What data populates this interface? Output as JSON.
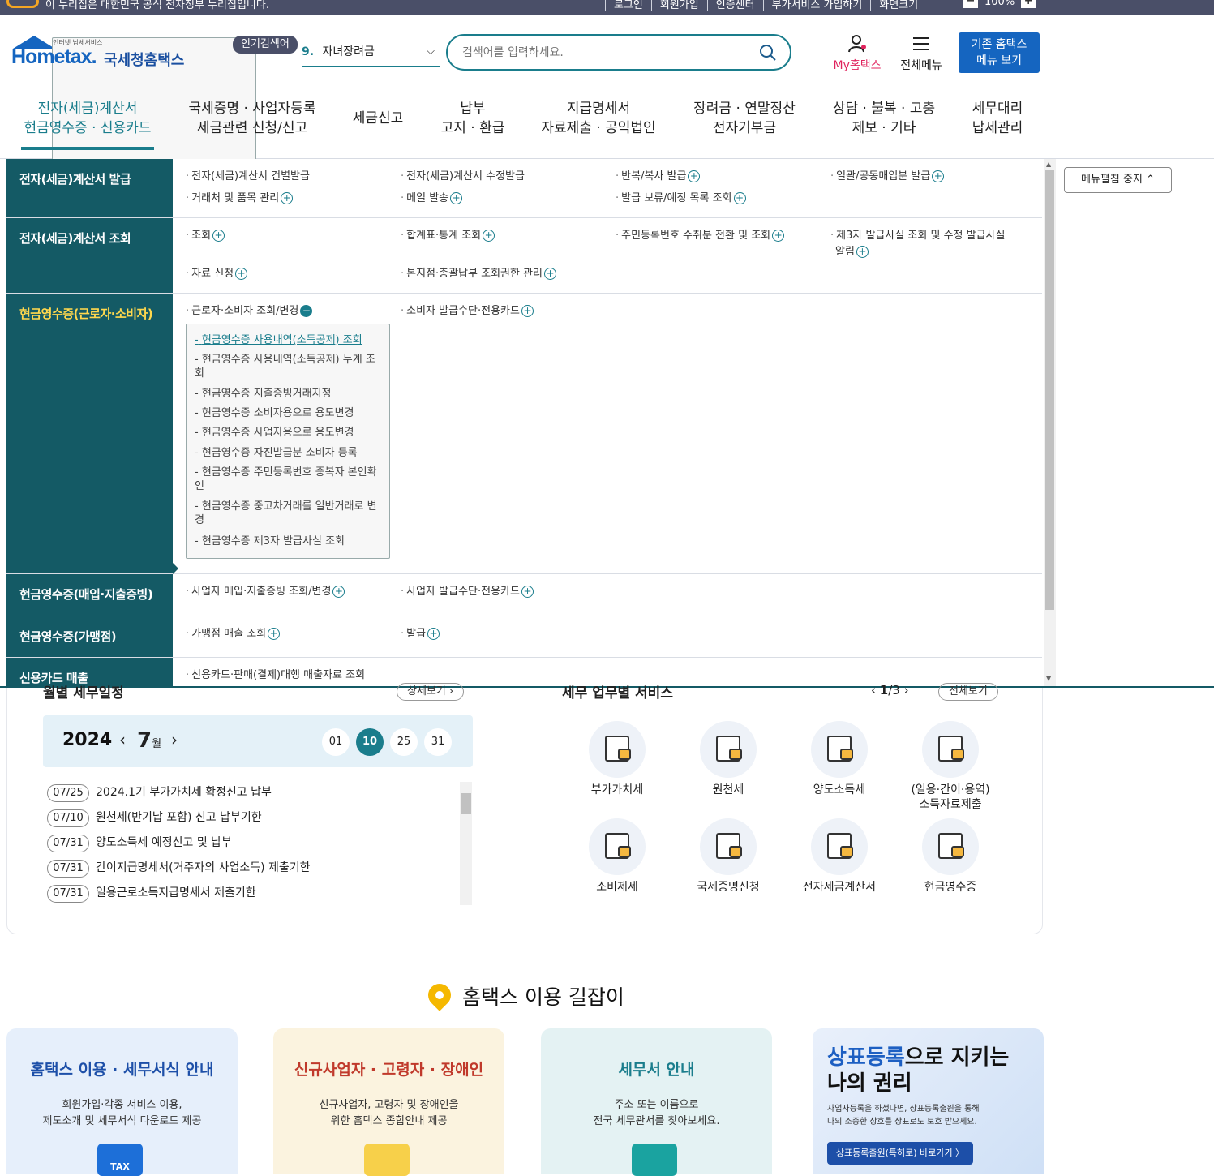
{
  "topbar": {
    "message": "이 누리집은 대한민국 공식 전자정부 누리집입니다.",
    "links": [
      "로그인",
      "회원가입",
      "인증센터",
      "부가서비스 가입하기",
      "화면크기"
    ],
    "zoom": "100%",
    "zoom_minus": "−",
    "zoom_plus": "+"
  },
  "header": {
    "logo_text": "Hometax.",
    "logo_sub": "인터넷 납세서비스",
    "logo_kor": "국세청홈택스",
    "popular_label": "인기검색어",
    "popular_num": "9.",
    "popular_word": "자녀장려금",
    "search_placeholder": "검색어를 입력하세요.",
    "my_label": "My홈택스",
    "all_menu": "전체메뉴",
    "old_menu_1": "기존 홈택스",
    "old_menu_2": "메뉴 보기"
  },
  "gnb": [
    {
      "l1": "전자(세금)계산서",
      "l2": "현금영수증 · 신용카드"
    },
    {
      "l1": "국세증명 · 사업자등록",
      "l2": "세금관련 신청/신고"
    },
    {
      "l1": "세금신고",
      "l2": ""
    },
    {
      "l1": "납부",
      "l2": "고지 · 환급"
    },
    {
      "l1": "지급명세서",
      "l2": "자료제출 · 공익법인"
    },
    {
      "l1": "장려금 · 연말정산",
      "l2": "전자기부금"
    },
    {
      "l1": "상담 · 불복 · 고충",
      "l2": "제보 · 기타"
    },
    {
      "l1": "세무대리",
      "l2": "납세관리"
    }
  ],
  "mega": {
    "cats": [
      "전자(세금)계산서 발급",
      "전자(세금)계산서 조회",
      "현금영수증(근로자·소비자)",
      "현금영수증(매입·지출증빙)",
      "현금영수증(가맹점)",
      "신용카드 매출"
    ],
    "r1": [
      "전자(세금)계산서 건별발급",
      "전자(세금)계산서 수정발급",
      "반복/복사 발급",
      "일괄/공동매입분 발급",
      "거래처 및 품목 관리",
      "메일 발송",
      "발급 보류/예정 목록 조회"
    ],
    "r2": [
      "조회",
      "합계표·통계 조회",
      "주민등록번호 수취분 전환 및 조회",
      "제3자 발급사실 조회 및 수정 발급사실",
      "알림",
      "자료 신청",
      "본지점·총괄납부 조회권한 관리"
    ],
    "r3": [
      "근로자·소비자 조회/변경",
      "소비자 발급수단·전용카드"
    ],
    "r3sub": [
      "현금영수증 사용내역(소득공제) 조회",
      "현금영수증 사용내역(소득공제) 누계 조회",
      "현금영수증 지출증빙거래지정",
      "현금영수증 소비자용으로 용도변경",
      "현금영수증 사업자용으로 용도변경",
      "현금영수증 자진발급분 소비자 등록",
      "현금영수증 주민등록번호 중복자 본인확인",
      "현금영수증 중고차거래를 일반거래로 변경",
      "현금영수증 제3자 발급사실 조회"
    ],
    "r4": [
      "사업자 매입·지출증빙 조회/변경",
      "사업자 발급수단·전용카드"
    ],
    "r5": [
      "가맹점 매출 조회",
      "발급"
    ],
    "r6": [
      "신용카드·판매(결제)대행 매출자료 조회"
    ],
    "plus": "+",
    "minus": "−",
    "bullet": "·",
    "subbullet": "-"
  },
  "fold_btn": "메뉴펼침 중지",
  "monthly": {
    "title": "월별 세무일정",
    "more": "상세보기",
    "year": "2024",
    "month": "7",
    "month_unit": "월",
    "days": [
      "01",
      "10",
      "25",
      "31"
    ],
    "active_day": "10",
    "schedule": [
      {
        "date": "07/25",
        "text": "2024.1기 부가가치세 확정신고 납부"
      },
      {
        "date": "07/10",
        "text": "원천세(반기납 포함) 신고 납부기한"
      },
      {
        "date": "07/31",
        "text": "양도소득세 예정신고 및 납부"
      },
      {
        "date": "07/31",
        "text": "간이지급명세서(거주자의 사업소득) 제출기한"
      },
      {
        "date": "07/31",
        "text": "일용근로소득지급명세서 제출기한"
      }
    ]
  },
  "services": {
    "title": "세무 업무별 서비스",
    "page": "1",
    "total": "3",
    "all": "전체보기",
    "items": [
      {
        "label": "부가가치세",
        "icon": "vat-icon"
      },
      {
        "label": "원천세",
        "icon": "sal-icon"
      },
      {
        "label": "양도소득세",
        "icon": "house-hand-icon"
      },
      {
        "label": "(일용·간이·용역) 소득자료제출",
        "icon": "house-coin-icon"
      },
      {
        "label": "소비제세",
        "icon": "cart-icon"
      },
      {
        "label": "국세증명신청",
        "icon": "certificate-icon"
      },
      {
        "label": "전자세금계산서",
        "icon": "tax-envelope-icon"
      },
      {
        "label": "현금영수증",
        "icon": "receipt-coin-icon"
      }
    ]
  },
  "guide": {
    "title": "홈택스 이용 길잡이",
    "cards": [
      {
        "title": "홈택스 이용 · 세무서식 안내",
        "desc1": "회원가입·각종 서비스 이용,",
        "desc2": "제도소개 및 세무서식 다운로드 제공",
        "color": "#1d4fa8",
        "bg": "#e6effb"
      },
      {
        "title": "신규사업자 · 고령자 · 장애인",
        "desc1": "신규사업자, 고령자 및 장애인을",
        "desc2": "위한 홈택스 종합안내 제공",
        "color": "#c0392b",
        "bg": "#fbf3df"
      },
      {
        "title": "세무서 안내",
        "desc1": "주소 또는 이름으로",
        "desc2": "전국 세무관서를 찾아보세요.",
        "color": "#1a7d8c",
        "bg": "#e4f2f3"
      }
    ],
    "trade_t1a": "상표등록",
    "trade_t1b": "으로 지키는",
    "trade_t1c": "나의 권리",
    "trade_t2a": "사업자등록을 하셨다면, 상표등록출원을 통해",
    "trade_t2b": "나의 소중한 상호를 상표로도 보호 받으세요.",
    "trade_btn": "상표등록출원(특허로) 바로가기 〉",
    "tax_badge": "TAX"
  }
}
